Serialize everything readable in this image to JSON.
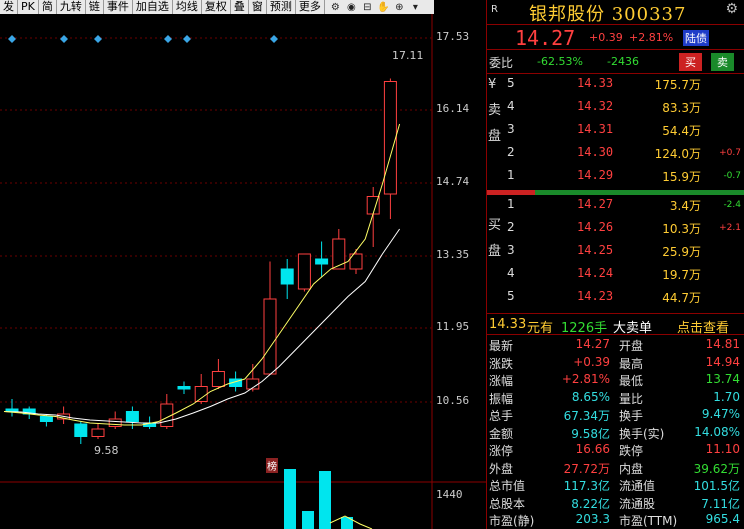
{
  "toolbar": {
    "items": [
      "发",
      "PK",
      "简",
      "九转",
      "链",
      "事件",
      "加自选",
      "均线",
      "复权",
      "叠",
      "窗",
      "预测",
      "更多"
    ],
    "icons": [
      "gear-icon",
      "eye-icon",
      "basket-icon",
      "hand-icon",
      "zoom-in-icon",
      "arrow-down-icon"
    ]
  },
  "axis": {
    "ticks": [
      "17.53",
      "16.14",
      "14.74",
      "13.35",
      "11.95",
      "10.56"
    ],
    "vol_tick": "1440",
    "high_label": "17.11",
    "low_label": "9.58",
    "bang": "榜"
  },
  "stock": {
    "r": "R",
    "name": "银邦股份 300337",
    "price": "14.27",
    "change": "+0.39",
    "pct": "+2.81%",
    "tag": "陆债"
  },
  "weibi": {
    "label": "委比",
    "ratio": "-62.53%",
    "diff": "-2436",
    "buy": "买",
    "sell": "卖"
  },
  "sell_book": {
    "label": [
      "¥",
      "卖",
      "",
      "盘"
    ],
    "rows": [
      {
        "n": "5",
        "price": "14.33",
        "vol": "175.7万",
        "ch": ""
      },
      {
        "n": "4",
        "price": "14.32",
        "vol": "83.3万",
        "ch": ""
      },
      {
        "n": "3",
        "price": "14.31",
        "vol": "54.4万",
        "ch": ""
      },
      {
        "n": "2",
        "price": "14.30",
        "vol": "124.0万",
        "ch": "+0.7"
      },
      {
        "n": "1",
        "price": "14.29",
        "vol": "15.9万",
        "ch": "-0.7"
      }
    ]
  },
  "buy_book": {
    "label": [
      "买",
      "",
      "盘"
    ],
    "rows": [
      {
        "n": "1",
        "price": "14.27",
        "vol": "3.4万",
        "ch": "-2.4"
      },
      {
        "n": "2",
        "price": "14.26",
        "vol": "10.3万",
        "ch": "+2.1"
      },
      {
        "n": "3",
        "price": "14.25",
        "vol": "25.9万",
        "ch": ""
      },
      {
        "n": "4",
        "price": "14.24",
        "vol": "19.7万",
        "ch": ""
      },
      {
        "n": "5",
        "price": "14.23",
        "vol": "44.7万",
        "ch": ""
      }
    ]
  },
  "trade": {
    "price": "14.33",
    "unit": "元有",
    "qty": "1226手",
    "type": "大卖单",
    "action": "点击查看"
  },
  "stats": [
    {
      "k1": "最新",
      "v1": "14.27",
      "k2": "开盘",
      "v2": "14.81"
    },
    {
      "k1": "涨跌",
      "v1": "+0.39",
      "k2": "最高",
      "v2": "14.94"
    },
    {
      "k1": "涨幅",
      "v1": "+2.81%",
      "k2": "最低",
      "v2": "13.74"
    },
    {
      "k1": "振幅",
      "v1": "8.65%",
      "k2": "量比",
      "v2": "1.70"
    },
    {
      "k1": "总手",
      "v1": "67.34万",
      "k2": "换手",
      "v2": "9.47%"
    },
    {
      "k1": "金额",
      "v1": "9.58亿",
      "k2": "换手(实)",
      "v2": "14.08%"
    },
    {
      "k1": "涨停",
      "v1": "16.66",
      "k2": "跌停",
      "v2": "11.10"
    },
    {
      "k1": "外盘",
      "v1": "27.72万",
      "k2": "内盘",
      "v2": "39.62万"
    },
    {
      "k1": "总市值",
      "v1": "117.3亿",
      "k2": "流通值",
      "v2": "101.5亿"
    },
    {
      "k1": "总股本",
      "v1": "8.22亿",
      "k2": "流通股",
      "v2": "7.11亿"
    },
    {
      "k1": "市盈(静)",
      "v1": "203.3",
      "k2": "市盈(TTM)",
      "v2": "965.4"
    }
  ],
  "colors": {
    "up": "#ff4040",
    "down": "#00e5ee",
    "ma5": "#ffff66",
    "ma10": "#ffffff"
  },
  "chart_data": {
    "type": "candlestick",
    "candles": [
      {
        "o": 10.5,
        "c": 10.45,
        "h": 10.7,
        "l": 10.35
      },
      {
        "o": 10.5,
        "c": 10.4,
        "h": 10.55,
        "l": 10.3
      },
      {
        "o": 10.35,
        "c": 10.25,
        "h": 10.4,
        "l": 10.15
      },
      {
        "o": 10.3,
        "c": 10.4,
        "h": 10.55,
        "l": 10.2
      },
      {
        "o": 10.2,
        "c": 9.95,
        "h": 10.25,
        "l": 9.8
      },
      {
        "o": 9.95,
        "c": 10.1,
        "h": 10.2,
        "l": 9.9
      },
      {
        "o": 10.15,
        "c": 10.3,
        "h": 10.45,
        "l": 10.1
      },
      {
        "o": 10.45,
        "c": 10.25,
        "h": 10.55,
        "l": 10.1
      },
      {
        "o": 10.2,
        "c": 10.15,
        "h": 10.35,
        "l": 10.1
      },
      {
        "o": 10.15,
        "c": 10.6,
        "h": 10.8,
        "l": 10.1
      },
      {
        "o": 10.95,
        "c": 10.9,
        "h": 11.05,
        "l": 10.8
      },
      {
        "o": 10.65,
        "c": 10.95,
        "h": 11.2,
        "l": 10.6
      },
      {
        "o": 10.95,
        "c": 11.25,
        "h": 11.5,
        "l": 10.9
      },
      {
        "o": 11.1,
        "c": 10.95,
        "h": 11.25,
        "l": 10.85
      },
      {
        "o": 10.9,
        "c": 11.1,
        "h": 11.4,
        "l": 10.85
      },
      {
        "o": 11.2,
        "c": 12.7,
        "h": 13.45,
        "l": 11.3
      },
      {
        "o": 13.3,
        "c": 13.0,
        "h": 13.5,
        "l": 12.7
      },
      {
        "o": 12.9,
        "c": 13.6,
        "h": 13.6,
        "l": 12.85
      },
      {
        "o": 13.5,
        "c": 13.4,
        "h": 13.85,
        "l": 13.15
      },
      {
        "o": 13.3,
        "c": 13.9,
        "h": 14.1,
        "l": 13.3
      },
      {
        "o": 13.3,
        "c": 13.6,
        "h": 13.7,
        "l": 13.2
      },
      {
        "o": 14.4,
        "c": 14.75,
        "h": 14.94,
        "l": 13.74
      },
      {
        "o": 14.8,
        "c": 17.05,
        "h": 17.11,
        "l": 14.3
      }
    ],
    "ma5": [
      10.45,
      10.42,
      10.38,
      10.35,
      10.28,
      10.22,
      10.2,
      10.18,
      10.18,
      10.25,
      10.42,
      10.6,
      10.85,
      11.0,
      11.1,
      11.5,
      12.0,
      12.5,
      13.0,
      13.3,
      13.45,
      13.9,
      15.0,
      16.2
    ],
    "ma10": [
      10.45,
      10.44,
      10.4,
      10.38,
      10.32,
      10.28,
      10.26,
      10.24,
      10.22,
      10.22,
      10.3,
      10.42,
      10.55,
      10.7,
      10.82,
      11.05,
      11.35,
      11.7,
      12.05,
      12.4,
      12.75,
      13.05,
      13.6,
      14.1
    ],
    "volumes": [
      0,
      0,
      0,
      0,
      0,
      0,
      0,
      0,
      0,
      0,
      0,
      0,
      0,
      0,
      0,
      0,
      0,
      0,
      1440,
      300,
      1500,
      600,
      200
    ],
    "ylim": [
      9.3,
      17.9
    ]
  }
}
